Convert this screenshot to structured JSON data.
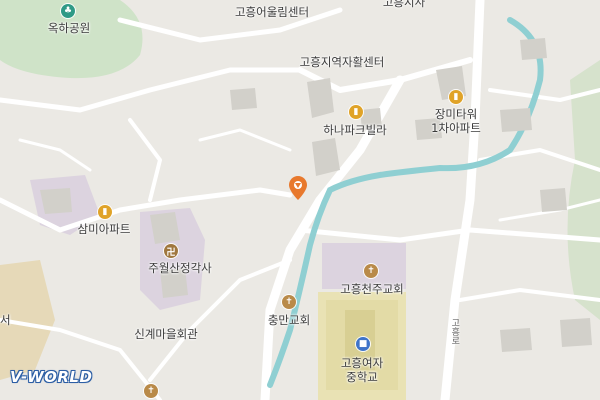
{
  "map": {
    "logo": "V-WORLD",
    "colors": {
      "background": "#ebe9e4",
      "road": "#ffffff",
      "building": "#d2d0ca",
      "park": "#cfe3c8",
      "water": "#8fcfd2",
      "school": "#e9e2b4",
      "church_area": "#dcd3df",
      "marker": "#e8792d"
    },
    "places": [
      {
        "id": "okha-park",
        "label": "옥하공원",
        "icon": "park-icon"
      },
      {
        "id": "goheung-eoullim",
        "label": "고흥어울림센터"
      },
      {
        "id": "goheung-gunchong",
        "label": "고흥지사"
      },
      {
        "id": "goheung-jiyeok",
        "label": "고흥지역자활센터"
      },
      {
        "id": "jangmi-tower",
        "label": "장미타워\n1차아파트",
        "icon": "apartment-icon"
      },
      {
        "id": "hana-park-villa",
        "label": "하나파크빌라",
        "icon": "apartment-icon"
      },
      {
        "id": "sammi-apt",
        "label": "삼미아파트",
        "icon": "apartment-icon"
      },
      {
        "id": "juwolsan",
        "label": "주월산정각사",
        "icon": "temple-icon"
      },
      {
        "id": "goheung-catholic",
        "label": "고흥천주교회",
        "icon": "church-icon"
      },
      {
        "id": "chungman-church",
        "label": "충만교회",
        "icon": "church-icon"
      },
      {
        "id": "singye-hall",
        "label": "신계마을회관"
      },
      {
        "id": "goheung-girls-ms",
        "label": "고흥여자\n중학교",
        "icon": "school-icon"
      },
      {
        "id": "road-label",
        "label": "고흥로"
      },
      {
        "id": "edge-label",
        "label": "서"
      }
    ]
  }
}
